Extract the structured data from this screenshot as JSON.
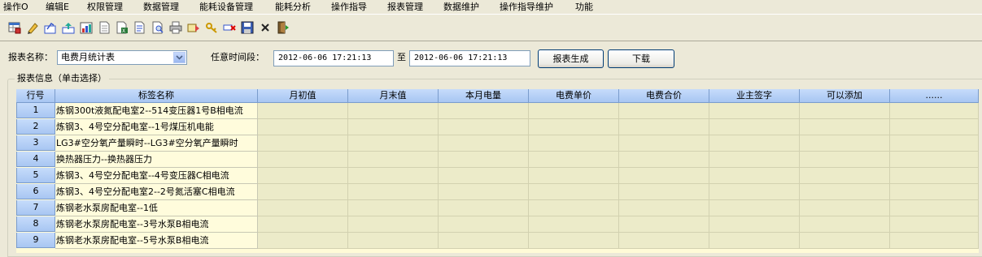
{
  "menu": [
    {
      "label": "操作O"
    },
    {
      "label": "编辑E"
    },
    {
      "label": "权限管理"
    },
    {
      "label": "数据管理"
    },
    {
      "label": "能耗设备管理"
    },
    {
      "label": "能耗分析"
    },
    {
      "label": "操作指导"
    },
    {
      "label": "报表管理"
    },
    {
      "label": "数据维护"
    },
    {
      "label": "操作指导维护"
    },
    {
      "label": "功能"
    }
  ],
  "toolbar": {
    "icons": [
      "grid-icon",
      "pencil-icon",
      "edit-icon",
      "import-icon",
      "chart-icon",
      "page-icon",
      "export-icon",
      "document-icon",
      "preview-icon",
      "print-icon",
      "send-icon",
      "key-icon",
      "delete-row-icon",
      "save-icon",
      "close-icon",
      "exit-icon"
    ]
  },
  "filter": {
    "report_name_label": "报表名称：",
    "report_name_value": "电费月统计表",
    "time_label": "任意时间段：",
    "start_time": "2012-06-06 17:21:13",
    "to_label": "至",
    "end_time": "2012-06-06 17:21:13",
    "generate_button": "报表生成",
    "download_button": "下载"
  },
  "group": {
    "title": "报表信息（单击选择）"
  },
  "table": {
    "columns": [
      "行号",
      "标签名称",
      "月初值",
      "月末值",
      "本月电量",
      "电费单价",
      "电费合价",
      "业主签字",
      "可以添加",
      "......"
    ],
    "rows": [
      {
        "num": "1",
        "name": "炼钢300t液氮配电室2--514变压器1号B相电流"
      },
      {
        "num": "2",
        "name": "炼钢3、4号空分配电室--1号煤压机电能"
      },
      {
        "num": "3",
        "name": "LG3#空分氧产量瞬时--LG3#空分氧产量瞬时"
      },
      {
        "num": "4",
        "name": "换热器压力--换热器压力"
      },
      {
        "num": "5",
        "name": "炼钢3、4号空分配电室--4号变压器C相电流"
      },
      {
        "num": "6",
        "name": "炼钢3、4号空分配电室2--2号氮活塞C相电流"
      },
      {
        "num": "7",
        "name": "炼钢老水泵房配电室--1低"
      },
      {
        "num": "8",
        "name": "炼钢老水泵房配电室--3号水泵B相电流"
      },
      {
        "num": "9",
        "name": "炼钢老水泵房配电室--5号水泵B相电流"
      }
    ]
  }
}
